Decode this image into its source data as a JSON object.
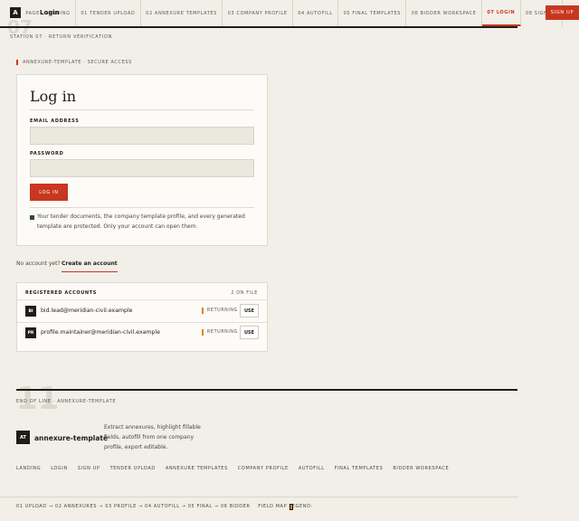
{
  "nav": {
    "logo_letter": "A",
    "logo_label": "Login",
    "items": [
      "PAGE · LANDING",
      "01 TENDER UPLOAD",
      "02 ANNEXURE TEMPLATES",
      "03 COMPANY PROFILE",
      "04 AUTOFILL",
      "05 FINAL TEMPLATES",
      "06 BIDDER WORKSPACE",
      "07 LOGIN",
      "08 SIGN UP"
    ],
    "active_index": 7,
    "signup_label": "SIGN UP",
    "ghost_number": "07"
  },
  "station": "STATION 07 · RETURN VERIFICATION",
  "section_label": "ANNEXURE-TEMPLATE · SECURE ACCESS",
  "login_card": {
    "title": "Log in",
    "email_label": "EMAIL ADDRESS",
    "email_value": "",
    "password_label": "PASSWORD",
    "password_value": "",
    "submit_label": "LOG IN",
    "note": "Your tender documents, the company template profile, and every generated template are protected. Only your account can open them."
  },
  "no_account": {
    "text": "No account yet?",
    "link": "Create an account"
  },
  "registered_accounts": {
    "title": "REGISTERED ACCOUNTS",
    "count": "2 ON FILE",
    "rows": [
      {
        "initials": "BI",
        "email": "bid.lead@meridian-civil.example",
        "status": "RETURNING",
        "action": "USE"
      },
      {
        "initials": "PR",
        "email": "profile.maintainer@meridian-civil.example",
        "status": "RETURNING",
        "action": "USE"
      }
    ]
  },
  "footer": {
    "ghost_number": "11",
    "end_line": "END OF LINE · ANNEXURE-TEMPLATE",
    "brand_initials": "AT",
    "brand_name": "annexure-template",
    "description": "Extract annexures, highlight fillable fields, autofill from one company profile, export editable.",
    "links": [
      "LANDING",
      "LOGIN",
      "SIGN UP",
      "TENDER UPLOAD",
      "ANNEXURE TEMPLATES",
      "COMPANY PROFILE",
      "AUTOFILL",
      "FINAL TEMPLATES",
      "BIDDER WORKSPACE"
    ],
    "flow": "01 UPLOAD → 02 ANNEXURES → 03 PROFILE → 04 AUTOFILL → 05 FINAL → 06 BIDDER    FIELD MAP LEGEND:",
    "legend_color": "#d08a1e"
  },
  "colors": {
    "accent": "#c8371f",
    "ink": "#1f1d1a",
    "paper": "#f2efe8"
  }
}
